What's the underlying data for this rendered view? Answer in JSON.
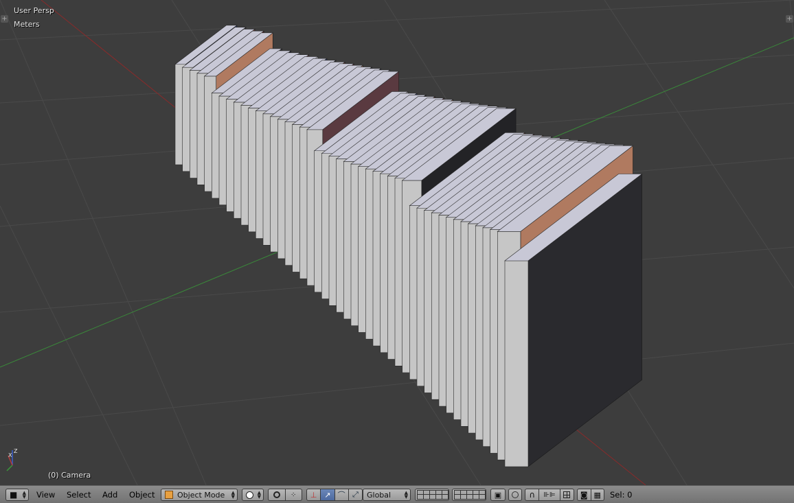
{
  "viewport": {
    "view_name": "User Persp",
    "units": "Meters",
    "object_info": "(0) Camera",
    "axis_labels": {
      "x": "X",
      "y": "Y",
      "z": "Z"
    },
    "colors": {
      "background": "#3d3d3d",
      "grid": "#4a4a4a",
      "x_axis": "#8a2a2a",
      "y_axis": "#3a8a3a"
    }
  },
  "header": {
    "editor_type_icon": "cube-icon",
    "menus": {
      "view": "View",
      "select": "Select",
      "add": "Add",
      "object": "Object"
    },
    "mode": "Object Mode",
    "mode_icon": "object-mode-icon",
    "shading_icon": "solid-sphere-icon",
    "pivot_icon": "pivot-point-icon",
    "transform_orientation": "Global",
    "selection_count": "Sel: 0"
  }
}
